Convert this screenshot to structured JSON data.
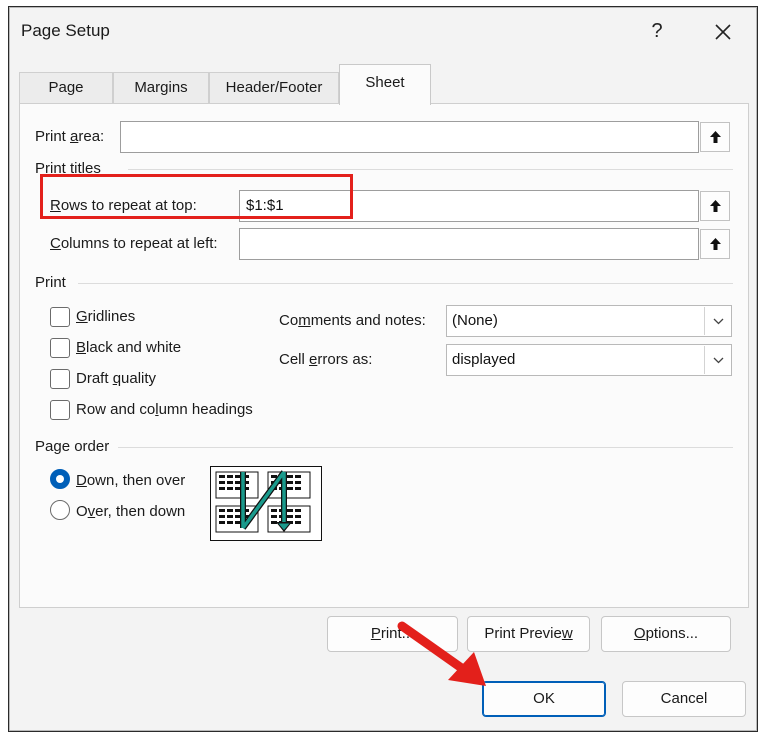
{
  "dialog": {
    "title": "Page Setup",
    "help_glyph": "?",
    "tabs": [
      {
        "label": "Page",
        "active": false
      },
      {
        "label": "Margins",
        "active": false
      },
      {
        "label": "Header/Footer",
        "active": false
      },
      {
        "label": "Sheet",
        "active": true
      }
    ]
  },
  "sheet": {
    "print_area": {
      "label_pre": "Print ",
      "label_key": "a",
      "label_post": "rea:",
      "value": ""
    },
    "print_titles": {
      "heading": "Print titles",
      "rows": {
        "label_key": "R",
        "label_post": "ows to repeat at top:",
        "value": "$1:$1"
      },
      "columns": {
        "label_key": "C",
        "label_post": "olumns to repeat at left:",
        "value": ""
      }
    },
    "print": {
      "heading": "Print",
      "checkboxes": [
        {
          "pre": "",
          "key": "G",
          "post": "ridlines",
          "checked": false
        },
        {
          "pre": "",
          "key": "B",
          "post": "lack and white",
          "checked": false
        },
        {
          "pre": "Draft ",
          "key": "q",
          "post": "uality",
          "checked": false
        },
        {
          "pre": "Row and co",
          "key": "l",
          "post": "umn headings",
          "checked": false
        }
      ],
      "comments": {
        "label_pre": "Co",
        "label_key": "m",
        "label_post": "ments and notes:",
        "value": "(None)"
      },
      "errors": {
        "label_pre": "Cell ",
        "label_key": "e",
        "label_post": "rrors as:",
        "value": "displayed"
      }
    },
    "page_order": {
      "heading": "Page order",
      "options": [
        {
          "pre": "",
          "key": "D",
          "post": "own, then over",
          "selected": true
        },
        {
          "pre": "O",
          "key": "v",
          "post": "er, then down",
          "selected": false
        }
      ]
    }
  },
  "buttons": {
    "print": {
      "pre": "",
      "key": "P",
      "post": "rint..."
    },
    "print_preview": {
      "pre": "Print Previe",
      "key": "w",
      "post": ""
    },
    "options": {
      "pre": "",
      "key": "O",
      "post": "ptions..."
    },
    "ok": "OK",
    "cancel": "Cancel"
  },
  "annotation": {
    "highlight_color": "#e3201b",
    "arrow_color": "#e3201b"
  },
  "colors": {
    "accent": "#005fb8",
    "diagram_arrow": "#1a9a8c"
  }
}
